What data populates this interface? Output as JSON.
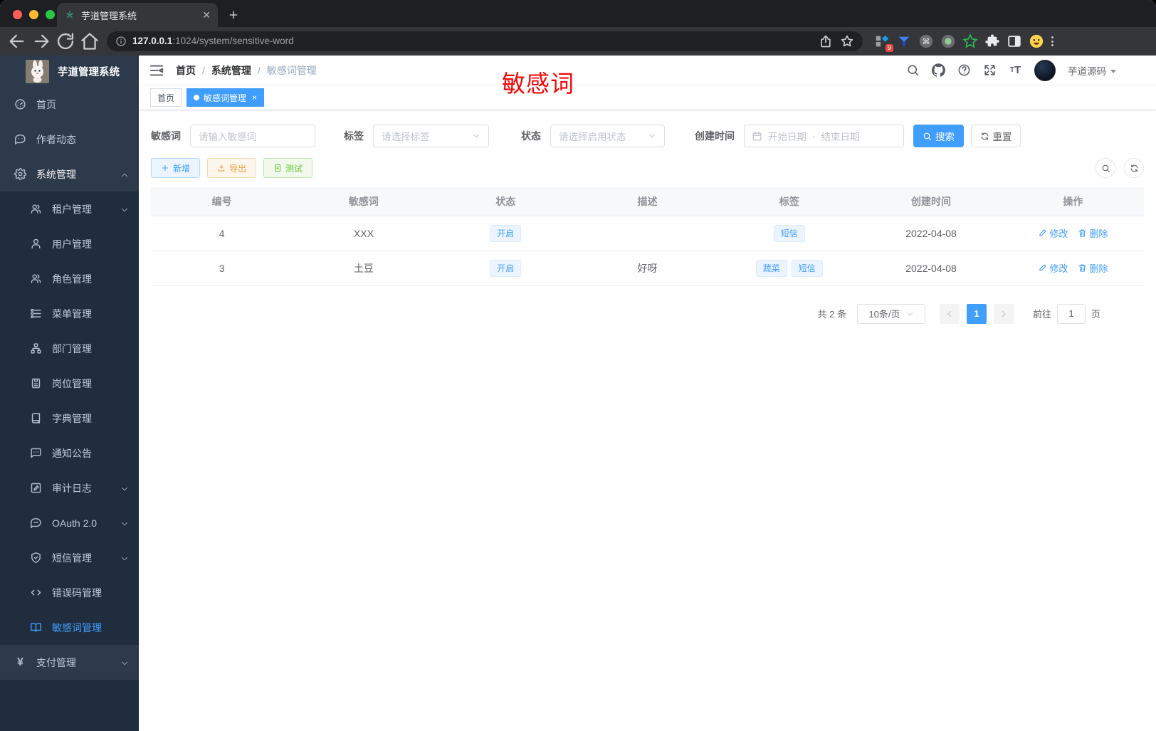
{
  "browser": {
    "tab_title": "芋道管理系统",
    "url_host": "127.0.0.1",
    "url_rest": ":1024/system/sensitive-word",
    "extension_badge": "9",
    "extensions": [
      "apps-grid",
      "vpn-gem",
      "command-circle",
      "record-circle",
      "green-star",
      "puzzle",
      "side-panel",
      "emoji-face"
    ]
  },
  "sidebar": {
    "logo_title": "芋道管理系统",
    "items": [
      {
        "label": "首页",
        "icon": "dashboard",
        "level": 1
      },
      {
        "label": "作者动态",
        "icon": "message",
        "level": 1
      },
      {
        "label": "系统管理",
        "icon": "gear",
        "level": 1,
        "chevron": "up",
        "open": true
      },
      {
        "label": "租户管理",
        "icon": "users",
        "level": 2,
        "chevron": "down"
      },
      {
        "label": "用户管理",
        "icon": "user",
        "level": 2
      },
      {
        "label": "角色管理",
        "icon": "roles",
        "level": 2
      },
      {
        "label": "菜单管理",
        "icon": "tree",
        "level": 2
      },
      {
        "label": "部门管理",
        "icon": "org",
        "level": 2
      },
      {
        "label": "岗位管理",
        "icon": "badge",
        "level": 2
      },
      {
        "label": "字典管理",
        "icon": "book",
        "level": 2
      },
      {
        "label": "通知公告",
        "icon": "chat",
        "level": 2
      },
      {
        "label": "审计日志",
        "icon": "logedit",
        "level": 2,
        "chevron": "down"
      },
      {
        "label": "OAuth 2.0",
        "icon": "oauth",
        "level": 2,
        "chevron": "down"
      },
      {
        "label": "短信管理",
        "icon": "shield",
        "level": 2,
        "chevron": "down"
      },
      {
        "label": "错误码管理",
        "icon": "code",
        "level": 2
      },
      {
        "label": "敏感词管理",
        "icon": "openbook",
        "level": 2,
        "active": true
      },
      {
        "label": "支付管理",
        "icon": "yen",
        "level": 1,
        "chevron": "down"
      }
    ]
  },
  "navbar": {
    "breadcrumb": [
      "首页",
      "系统管理",
      "敏感词管理"
    ],
    "annotation": "敏感词",
    "username": "芋道源码"
  },
  "tabs": [
    {
      "label": "首页",
      "active": false,
      "closable": false
    },
    {
      "label": "敏感词管理",
      "active": true,
      "closable": true
    }
  ],
  "filters": {
    "keyword_label": "敏感词",
    "keyword_placeholder": "请输入敏感词",
    "tag_label": "标签",
    "tag_placeholder": "请选择标签",
    "status_label": "状态",
    "status_placeholder": "请选择启用状态",
    "date_label": "创建时间",
    "date_start_placeholder": "开始日期",
    "date_separator": "-",
    "date_end_placeholder": "结束日期",
    "search_label": "搜索",
    "reset_label": "重置"
  },
  "toolbar": {
    "add_label": "新增",
    "export_label": "导出",
    "test_label": "测试"
  },
  "table": {
    "columns": [
      "编号",
      "敏感词",
      "状态",
      "描述",
      "标签",
      "创建时间",
      "操作"
    ],
    "rows": [
      {
        "id": "4",
        "word": "XXX",
        "status": "开启",
        "description": "",
        "tags": [
          "短信"
        ],
        "create_time": "2022-04-08",
        "actions": [
          "修改",
          "删除"
        ]
      },
      {
        "id": "3",
        "word": "土豆",
        "status": "开启",
        "description": "好呀",
        "tags": [
          "蔬菜",
          "短信"
        ],
        "create_time": "2022-04-08",
        "actions": [
          "修改",
          "删除"
        ]
      }
    ]
  },
  "pagination": {
    "total_text": "共 2 条",
    "page_size": "10条/页",
    "current_page": "1",
    "goto_label": "前往",
    "goto_value": "1",
    "page_unit": "页"
  },
  "colors": {
    "primary": "#409eff",
    "warning": "#e6a23c",
    "success": "#67c23a",
    "annotation_red": "#f40606",
    "sidebar_bg": "#2d3a4b",
    "submenu_bg": "#1f2d3d"
  }
}
